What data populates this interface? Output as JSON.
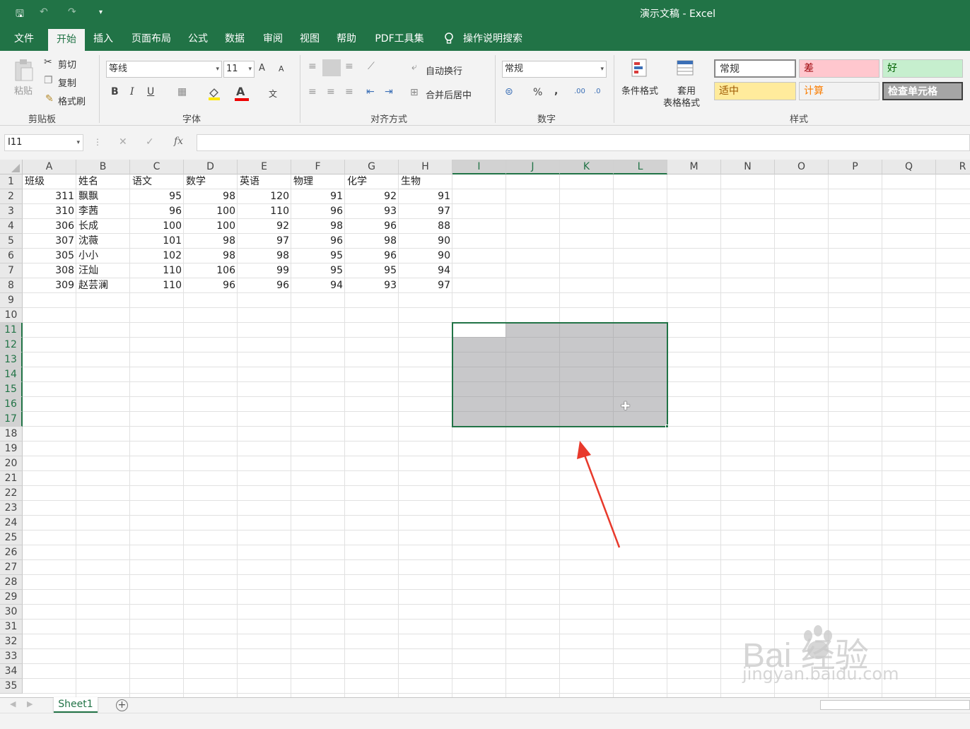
{
  "window": {
    "title": "演示文稿 - Excel"
  },
  "quick_access": {
    "save": "🖫",
    "undo": "↶",
    "redo": "↷",
    "customize": "▾"
  },
  "tabs": [
    {
      "label": "文件",
      "active": false
    },
    {
      "label": "开始",
      "active": true
    },
    {
      "label": "插入",
      "active": false
    },
    {
      "label": "页面布局",
      "active": false
    },
    {
      "label": "公式",
      "active": false
    },
    {
      "label": "数据",
      "active": false
    },
    {
      "label": "审阅",
      "active": false
    },
    {
      "label": "视图",
      "active": false
    },
    {
      "label": "帮助",
      "active": false
    },
    {
      "label": "PDF工具集",
      "active": false
    }
  ],
  "tell_me": "操作说明搜索",
  "ribbon": {
    "clipboard": {
      "paste": "粘贴",
      "cut": "剪切",
      "copy": "复制",
      "format_painter": "格式刷",
      "group": "剪贴板"
    },
    "font": {
      "name": "等线",
      "size": "11",
      "grow": "A",
      "shrink": "A",
      "bold": "B",
      "italic": "I",
      "underline": "U",
      "font_color": "A",
      "phonetic": "文",
      "group": "字体"
    },
    "alignment": {
      "wrap": "自动换行",
      "merge": "合并后居中",
      "group": "对齐方式"
    },
    "number": {
      "format": "常规",
      "percent": "%",
      "comma": ",",
      "group": "数字"
    },
    "styles": {
      "conditional": "条件格式",
      "table_1": "套用",
      "table_2": "表格格式",
      "normal": "常规",
      "bad": "差",
      "good": "好",
      "neutral": "适中",
      "calc": "计算",
      "check": "检查单元格",
      "group": "样式"
    }
  },
  "formula_bar": {
    "name_box": "I11",
    "cancel": "✕",
    "enter": "✓",
    "fx": "fx",
    "value": ""
  },
  "grid": {
    "columns": [
      "A",
      "B",
      "C",
      "D",
      "E",
      "F",
      "G",
      "H",
      "I",
      "J",
      "K",
      "L",
      "M",
      "N",
      "O",
      "P",
      "Q",
      "R"
    ],
    "selected_columns": [
      "I",
      "J",
      "K",
      "L"
    ],
    "row_count": 35,
    "selected_rows": [
      11,
      12,
      13,
      14,
      15,
      16,
      17
    ],
    "headers": [
      "班级",
      "姓名",
      "语文",
      "数学",
      "英语",
      "物理",
      "化学",
      "生物"
    ],
    "rows": [
      [
        "311",
        "飘飘",
        "95",
        "98",
        "120",
        "91",
        "92",
        "91"
      ],
      [
        "310",
        "李茜",
        "96",
        "100",
        "110",
        "96",
        "93",
        "97"
      ],
      [
        "306",
        "长成",
        "100",
        "100",
        "92",
        "98",
        "96",
        "88"
      ],
      [
        "307",
        "沈薇",
        "101",
        "98",
        "97",
        "96",
        "98",
        "90"
      ],
      [
        "305",
        "小小",
        "102",
        "98",
        "98",
        "95",
        "96",
        "90"
      ],
      [
        "308",
        "汪灿",
        "110",
        "106",
        "99",
        "95",
        "95",
        "94"
      ],
      [
        "309",
        "赵芸澜",
        "110",
        "96",
        "96",
        "94",
        "93",
        "97"
      ]
    ],
    "selection": "I11:L17"
  },
  "sheets": [
    {
      "name": "Sheet1",
      "active": true
    }
  ],
  "add_sheet": "+",
  "watermark": {
    "brand": "Bai 经验",
    "url": "jingyan.baidu.com"
  },
  "colors": {
    "excel_green": "#217346",
    "selection_fill": "#c8c8ca",
    "arrow": "#e8392b"
  }
}
